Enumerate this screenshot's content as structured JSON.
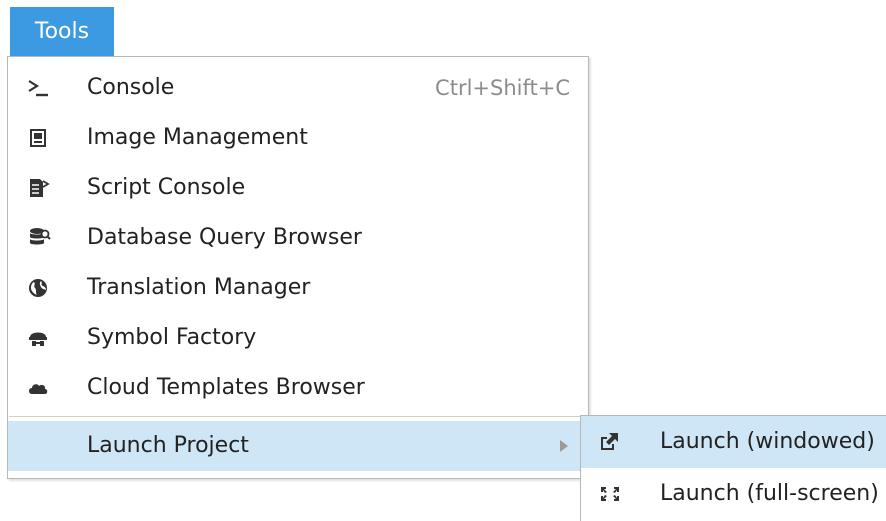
{
  "menubar": {
    "tools_label": "Tools"
  },
  "tools_menu": {
    "items": [
      {
        "label": "Console",
        "shortcut": "Ctrl+Shift+C",
        "icon": "console-icon"
      },
      {
        "label": "Image Management",
        "icon": "image-management-icon"
      },
      {
        "label": "Script Console",
        "icon": "script-console-icon"
      },
      {
        "label": "Database Query Browser",
        "icon": "database-query-icon"
      },
      {
        "label": "Translation Manager",
        "icon": "globe-icon"
      },
      {
        "label": "Symbol Factory",
        "icon": "symbol-factory-icon"
      },
      {
        "label": "Cloud Templates Browser",
        "icon": "cloud-icon"
      },
      {
        "label": "Launch Project",
        "has_submenu": true
      }
    ]
  },
  "launch_submenu": {
    "items": [
      {
        "label": "Launch (windowed)",
        "icon": "external-launch-icon"
      },
      {
        "label": "Launch (full-screen)",
        "icon": "fullscreen-icon"
      }
    ]
  },
  "colors": {
    "menubar_active": "#3b9ae1",
    "highlight": "#cfe6f7",
    "shortcut_text": "#8c8c8c"
  }
}
